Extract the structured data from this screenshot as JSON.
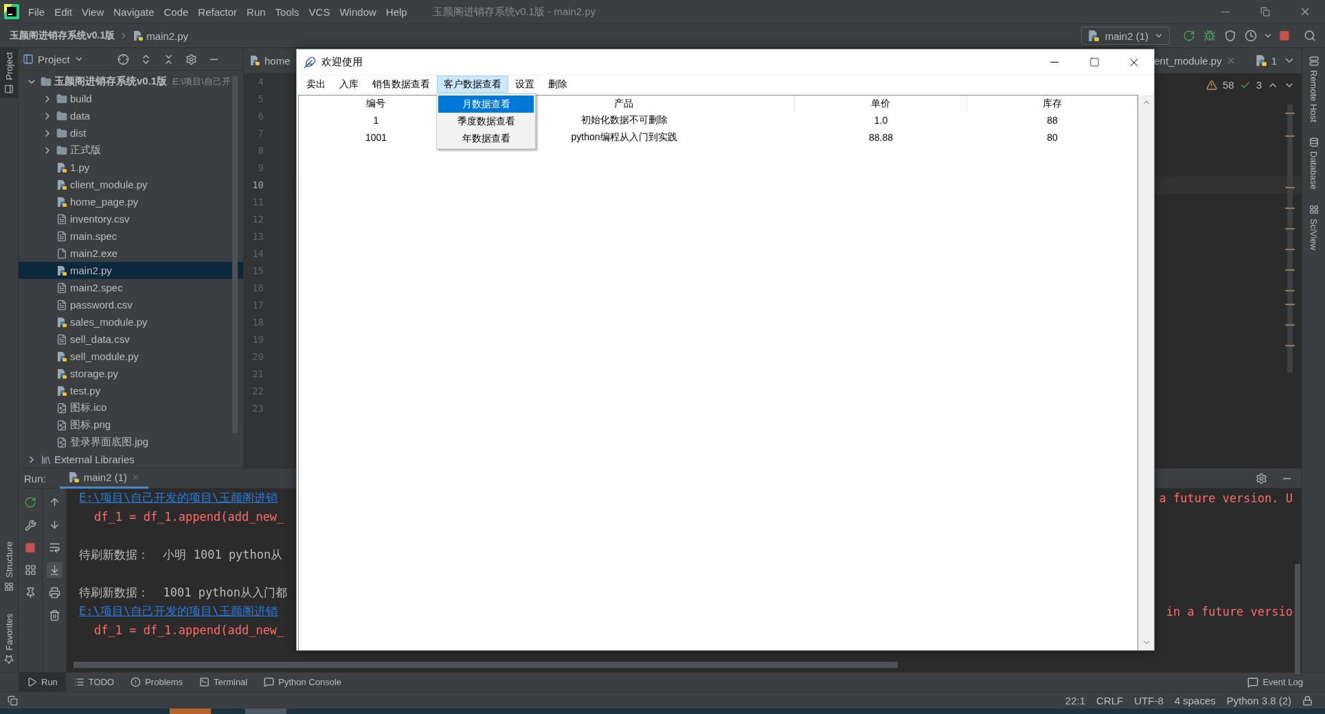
{
  "title_bar": {
    "menu": [
      "File",
      "Edit",
      "View",
      "Navigate",
      "Code",
      "Refactor",
      "Run",
      "Tools",
      "VCS",
      "Window",
      "Help"
    ],
    "title": "玉颜阁进销存系统v0.1版 - main2.py"
  },
  "nav_bar": {
    "breadcrumb": [
      "玉颜阁进销存系统v0.1版",
      "main2.py"
    ],
    "run_config": "main2 (1)"
  },
  "left_stripe": [
    {
      "label": "Project",
      "selected": true
    },
    {
      "label": "Structure",
      "selected": false
    },
    {
      "label": "Favorites",
      "selected": false
    }
  ],
  "project_panel": {
    "title": "Project",
    "tree": [
      {
        "label": "玉颜阁进销存系统v0.1版",
        "path": "E:\\项目\\自己开",
        "kind": "folder",
        "expanded": true,
        "selected": false,
        "children": [
          {
            "label": "build",
            "kind": "folder",
            "expanded": false,
            "selected": false
          },
          {
            "label": "data",
            "kind": "folder",
            "expanded": false,
            "selected": false
          },
          {
            "label": "dist",
            "kind": "folder",
            "expanded": false,
            "selected": false
          },
          {
            "label": "正式版",
            "kind": "folder",
            "expanded": false,
            "selected": false
          },
          {
            "label": "1.py",
            "kind": "python",
            "selected": false
          },
          {
            "label": "client_module.py",
            "kind": "python",
            "selected": false
          },
          {
            "label": "home_page.py",
            "kind": "python",
            "selected": false
          },
          {
            "label": "inventory.csv",
            "kind": "text",
            "selected": false
          },
          {
            "label": "main.spec",
            "kind": "text",
            "selected": false
          },
          {
            "label": "main2.exe",
            "kind": "unknown",
            "selected": false
          },
          {
            "label": "main2.py",
            "kind": "python",
            "selected": true
          },
          {
            "label": "main2.spec",
            "kind": "text",
            "selected": false
          },
          {
            "label": "password.csv",
            "kind": "text",
            "selected": false
          },
          {
            "label": "sales_module.py",
            "kind": "python",
            "selected": false
          },
          {
            "label": "sell_data.csv",
            "kind": "text",
            "selected": false
          },
          {
            "label": "sell_module.py",
            "kind": "python",
            "selected": false
          },
          {
            "label": "storage.py",
            "kind": "python",
            "selected": false
          },
          {
            "label": "test.py",
            "kind": "python",
            "selected": false
          },
          {
            "label": "图标.ico",
            "kind": "image",
            "selected": false
          },
          {
            "label": "图标.png",
            "kind": "image",
            "selected": false
          },
          {
            "label": "登录界面底图.jpg",
            "kind": "image",
            "selected": false
          }
        ]
      },
      {
        "label": "External Libraries",
        "kind": "library",
        "expanded": false,
        "selected": false
      }
    ]
  },
  "editor": {
    "tabs": [
      {
        "label": "home",
        "selected": false
      },
      {
        "label": "ent_module.py",
        "selected": false
      }
    ],
    "tab_overflow": "1",
    "warnings": "58",
    "weak_warnings": "3",
    "line_numbers": [
      {
        "number": "4",
        "current": false
      },
      {
        "number": "5",
        "current": false
      },
      {
        "number": "6",
        "current": false
      },
      {
        "number": "7",
        "current": false
      },
      {
        "number": "8",
        "current": false
      },
      {
        "number": "9",
        "current": false
      },
      {
        "number": "10",
        "current": true
      },
      {
        "number": "11",
        "current": false
      },
      {
        "number": "12",
        "current": false
      },
      {
        "number": "13",
        "current": false
      },
      {
        "number": "14",
        "current": false
      },
      {
        "number": "15",
        "current": false
      },
      {
        "number": "16",
        "current": false
      },
      {
        "number": "17",
        "current": false
      },
      {
        "number": "18",
        "current": false
      },
      {
        "number": "19",
        "current": false
      },
      {
        "number": "20",
        "current": false
      },
      {
        "number": "21",
        "current": false
      },
      {
        "number": "22",
        "current": false
      },
      {
        "number": "23",
        "current": false
      }
    ]
  },
  "right_stripe": [
    "Remote Host",
    "Database",
    "SciView"
  ],
  "run_panel": {
    "label": "Run:",
    "tab": "main2 (1)",
    "console": [
      {
        "kind": "link",
        "text": "E:\\项目\\自己开发的项目\\玉颜阁进销",
        "tail": "a future version. U"
      },
      {
        "kind": "error",
        "text": "df_1 = df_1.append(add_new_"
      },
      {
        "kind": "blank"
      },
      {
        "kind": "output",
        "text": "待刷新数据：  小明 1001 python从"
      },
      {
        "kind": "blank"
      },
      {
        "kind": "output",
        "text": "待刷新数据：  1001 python从入门都"
      },
      {
        "kind": "link",
        "text": "E:\\项目\\自己开发的项目\\玉颜阁进销",
        "tail": "in a future versio"
      },
      {
        "kind": "error",
        "text": "df_1 = df_1.append(add_new_"
      }
    ]
  },
  "tool_windows": [
    {
      "label": "Run",
      "selected": true
    },
    {
      "label": "TODO",
      "selected": false
    },
    {
      "label": "Problems",
      "selected": false
    },
    {
      "label": "Terminal",
      "selected": false
    },
    {
      "label": "Python Console",
      "selected": false
    }
  ],
  "event_log": "Event Log",
  "status_bar": [
    "22:1",
    "CRLF",
    "UTF-8",
    "4 spaces",
    "Python 3.8 (2)"
  ],
  "dialog": {
    "title": "欢迎使用",
    "menu": [
      {
        "label": "卖出",
        "selected": false
      },
      {
        "label": "入库",
        "selected": false
      },
      {
        "label": "销售数据查看",
        "selected": false
      },
      {
        "label": "客户数据查看",
        "selected": true
      },
      {
        "label": "设置",
        "selected": false
      },
      {
        "label": "删除",
        "selected": false
      }
    ],
    "dropdown": [
      {
        "label": "月数据查看",
        "selected": true
      },
      {
        "label": "季度数据查看",
        "selected": false
      },
      {
        "label": "年数据查看",
        "selected": false
      }
    ],
    "table": {
      "columns": [
        "编号",
        "产品",
        "单价",
        "库存"
      ],
      "rows": [
        [
          "1",
          "初始化数据不可删除",
          "1.0",
          "88"
        ],
        [
          "1001",
          "python编程从入门到实践",
          "88.88",
          "80"
        ]
      ]
    }
  }
}
